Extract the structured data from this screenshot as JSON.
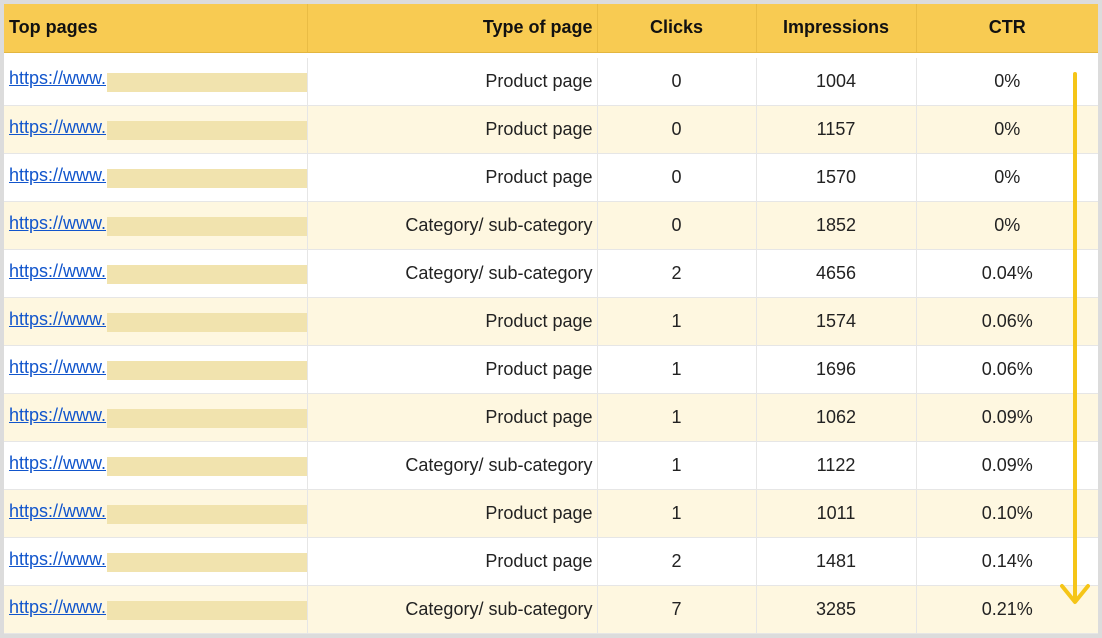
{
  "table": {
    "headers": {
      "url": "Top pages",
      "type": "Type of page",
      "clicks": "Clicks",
      "impressions": "Impressions",
      "ctr": "CTR"
    },
    "rows": [
      {
        "url": "https://www.",
        "type": "Product page",
        "clicks": "0",
        "impressions": "1004",
        "ctr": "0%"
      },
      {
        "url": "https://www.",
        "type": "Product page",
        "clicks": "0",
        "impressions": "1157",
        "ctr": "0%"
      },
      {
        "url": "https://www.",
        "type": "Product page",
        "clicks": "0",
        "impressions": "1570",
        "ctr": "0%"
      },
      {
        "url": "https://www.",
        "type": "Category/ sub-category",
        "clicks": "0",
        "impressions": "1852",
        "ctr": "0%"
      },
      {
        "url": "https://www.",
        "type": "Category/ sub-category",
        "clicks": "2",
        "impressions": "4656",
        "ctr": "0.04%"
      },
      {
        "url": "https://www.",
        "type": "Product page",
        "clicks": "1",
        "impressions": "1574",
        "ctr": "0.06%"
      },
      {
        "url": "https://www.",
        "type": "Product page",
        "clicks": "1",
        "impressions": "1696",
        "ctr": "0.06%"
      },
      {
        "url": "https://www.",
        "type": "Product page",
        "clicks": "1",
        "impressions": "1062",
        "ctr": "0.09%"
      },
      {
        "url": "https://www.",
        "type": "Category/ sub-category",
        "clicks": "1",
        "impressions": "1122",
        "ctr": "0.09%"
      },
      {
        "url": "https://www.",
        "type": "Product page",
        "clicks": "1",
        "impressions": "1011",
        "ctr": "0.10%"
      },
      {
        "url": "https://www.",
        "type": "Product page",
        "clicks": "2",
        "impressions": "1481",
        "ctr": "0.14%"
      },
      {
        "url": "https://www.",
        "type": "Category/ sub-category",
        "clicks": "7",
        "impressions": "3285",
        "ctr": "0.21%"
      }
    ]
  },
  "colors": {
    "header_bg": "#f8cb52",
    "row_alt_bg": "#fef7e0",
    "link": "#1155cc",
    "redaction": "#f1e3ae",
    "arrow": "#f5c518"
  },
  "icons": {
    "sort_indicator": "down-arrow-icon"
  }
}
